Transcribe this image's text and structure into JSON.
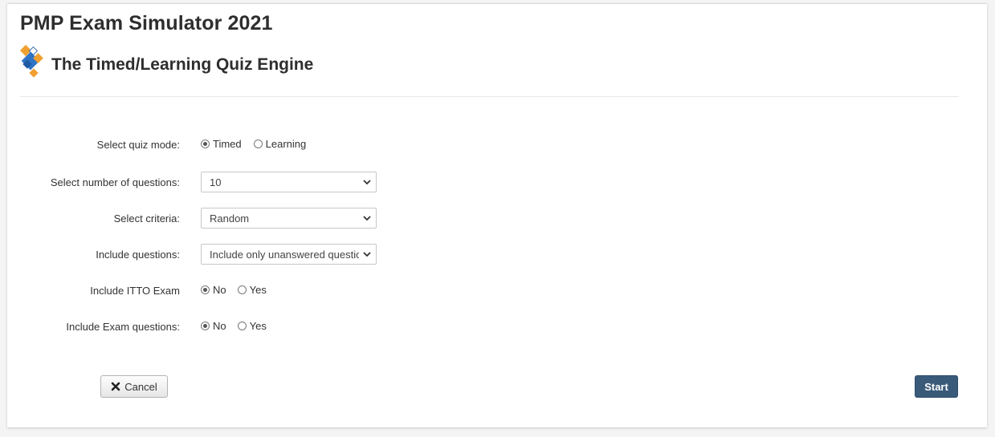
{
  "header": {
    "app_title": "PMP Exam Simulator 2021",
    "engine_title": "The Timed/Learning Quiz Engine",
    "logo_icon": "diamond-logo-icon",
    "logo_colors": {
      "orange": "#f0a030",
      "blue": "#2f73c4"
    }
  },
  "form": {
    "quiz_mode": {
      "label": "Select quiz mode:",
      "options": [
        "Timed",
        "Learning"
      ],
      "selected": "Timed"
    },
    "num_questions": {
      "label": "Select number of questions:",
      "value": "10"
    },
    "criteria": {
      "label": "Select criteria:",
      "value": "Random"
    },
    "include_questions": {
      "label": "Include questions:",
      "value": "Include only unanswered questions"
    },
    "itto_exam": {
      "label": "Include ITTO Exam",
      "options": [
        "No",
        "Yes"
      ],
      "selected": "No"
    },
    "exam_questions": {
      "label": "Include Exam questions:",
      "options": [
        "No",
        "Yes"
      ],
      "selected": "No"
    }
  },
  "buttons": {
    "cancel_label": "Cancel",
    "start_label": "Start"
  },
  "colors": {
    "start_button": "#3a5a7a"
  }
}
